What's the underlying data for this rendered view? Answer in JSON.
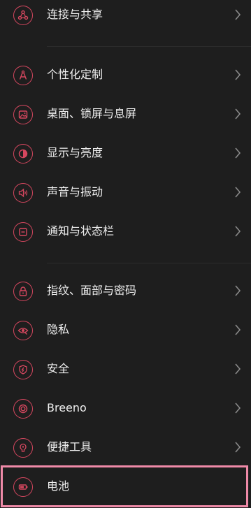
{
  "settings": {
    "items": [
      {
        "label": "连接与共享",
        "icon": "share-icon"
      },
      {
        "label": "个性化定制",
        "icon": "personalize-icon"
      },
      {
        "label": "桌面、锁屏与息屏",
        "icon": "wallpaper-icon"
      },
      {
        "label": "显示与亮度",
        "icon": "brightness-icon"
      },
      {
        "label": "声音与振动",
        "icon": "sound-icon"
      },
      {
        "label": "通知与状态栏",
        "icon": "notification-icon"
      },
      {
        "label": "指纹、面部与密码",
        "icon": "lock-icon"
      },
      {
        "label": "隐私",
        "icon": "privacy-eye-icon"
      },
      {
        "label": "安全",
        "icon": "security-shield-icon"
      },
      {
        "label": "Breeno",
        "icon": "breeno-icon"
      },
      {
        "label": "便捷工具",
        "icon": "tools-icon"
      },
      {
        "label": "电池",
        "icon": "battery-icon"
      }
    ]
  },
  "watermark": "",
  "colors": {
    "accent": "#d5475f",
    "background": "#1e1e1e",
    "highlight_border": "#ef8aa8"
  }
}
